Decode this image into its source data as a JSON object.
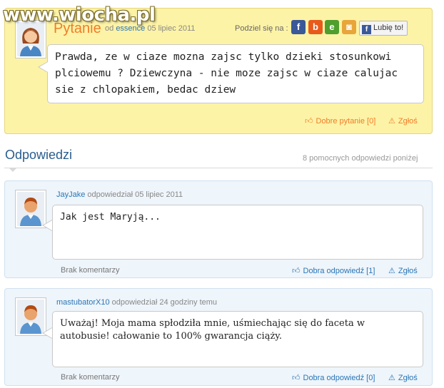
{
  "watermark": "www.wiocha.pl",
  "question": {
    "title": "Pytanie",
    "author_prefix": "od",
    "author": "essence",
    "date": "05 lipiec 2011",
    "share_label": "Podziel się na :",
    "share_icons": [
      "facebook-icon",
      "blip-icon",
      "wykop-icon",
      "nk-icon"
    ],
    "like_label": "Lubię to!",
    "text": "Prawda, ze w ciaze mozna zajsc tylko dzieki stosunkowi plciowemu ? Dziewczyna - nie moze zajsc w ciaze calujac sie z chlopakiem, bedac dziew",
    "good_question": "Dobre pytanie [0]",
    "report": "Zgłoś"
  },
  "answers_header": {
    "title": "Odpowiedzi",
    "count_text": "8 pomocnych odpowiedzi poniżej"
  },
  "answers": [
    {
      "author": "JayJake",
      "meta": "odpowiedział 05 lipiec 2011",
      "text": "Jak jest Maryją...",
      "comments": "Brak komentarzy",
      "good_answer": "Dobra odpowiedź [1]",
      "report": "Zgłoś"
    },
    {
      "author": "mastubatorX10",
      "meta": "odpowiedział 24 godziny temu",
      "text": "Uważaj! Moja mama spłodziła mnie, uśmiechając się do faceta w autobusie! całowanie to 100% gwarancja ciąży.",
      "comments": "Brak komentarzy",
      "good_answer": "Dobra odpowiedź [0]",
      "report": "Zgłoś"
    }
  ],
  "colors": {
    "question_bg": "#fdf3a6",
    "answer_bg": "#eef5fb",
    "accent_orange": "#f07c2a",
    "link_blue": "#2a76b5"
  }
}
